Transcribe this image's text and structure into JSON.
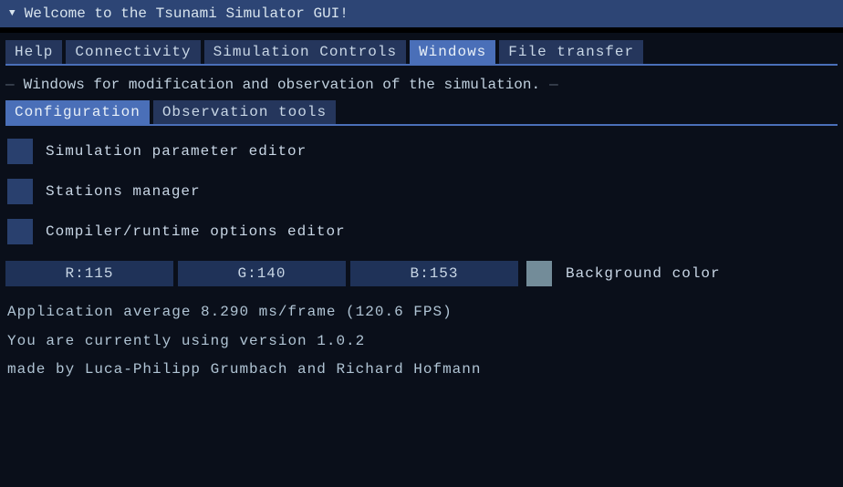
{
  "title": "Welcome to the Tsunami Simulator GUI!",
  "main_tabs": {
    "items": [
      {
        "label": "Help",
        "active": false
      },
      {
        "label": "Connectivity",
        "active": false
      },
      {
        "label": "Simulation Controls",
        "active": false
      },
      {
        "label": "Windows",
        "active": true
      },
      {
        "label": "File transfer",
        "active": false
      }
    ]
  },
  "section_text": "Windows for modification and observation of the simulation.",
  "sub_tabs": {
    "items": [
      {
        "label": "Configuration",
        "active": true
      },
      {
        "label": "Observation tools",
        "active": false
      }
    ]
  },
  "checkboxes": [
    {
      "label": "Simulation parameter editor"
    },
    {
      "label": "Stations manager"
    },
    {
      "label": "Compiler/runtime options editor"
    }
  ],
  "color": {
    "r_label": "R:115",
    "g_label": "G:140",
    "b_label": "B:153",
    "swatch_hex": "#738c99",
    "label": "Background color"
  },
  "stats": {
    "frame": "Application average 8.290 ms/frame (120.6 FPS)",
    "version": "You are currently using version 1.0.2",
    "credits": "made by Luca-Philipp Grumbach and Richard Hofmann"
  }
}
